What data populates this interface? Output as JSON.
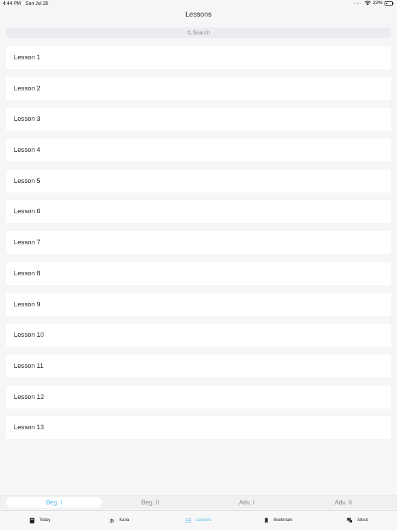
{
  "status_bar": {
    "time": "4:44 PM",
    "date": "Sun Jul 28",
    "battery": "22%",
    "battery_level": 0.22
  },
  "nav": {
    "title": "Lessons"
  },
  "search": {
    "placeholder": "Search"
  },
  "lessons": [
    "Lesson 1",
    "Lesson 2",
    "Lesson 3",
    "Lesson 4",
    "Lesson 5",
    "Lesson 6",
    "Lesson 7",
    "Lesson 8",
    "Lesson 9",
    "Lesson 10",
    "Lesson 11",
    "Lesson 12",
    "Lesson 13"
  ],
  "levels": {
    "items": [
      "Beg. I",
      "Beg. II",
      "Adv. I",
      "Adv. II"
    ],
    "selected": "Beg. I"
  },
  "tabs": [
    {
      "label": "Today",
      "icon": "book-icon"
    },
    {
      "label": "Kana",
      "icon": "kana-icon"
    },
    {
      "label": "Lessons",
      "icon": "list-icon"
    },
    {
      "label": "Bookmark",
      "icon": "bookmark-icon"
    },
    {
      "label": "About",
      "icon": "chat-bubbles-icon"
    }
  ],
  "colors": {
    "accent": "#56b8ec",
    "background": "#f6f6f8",
    "row": "#ffffff"
  }
}
